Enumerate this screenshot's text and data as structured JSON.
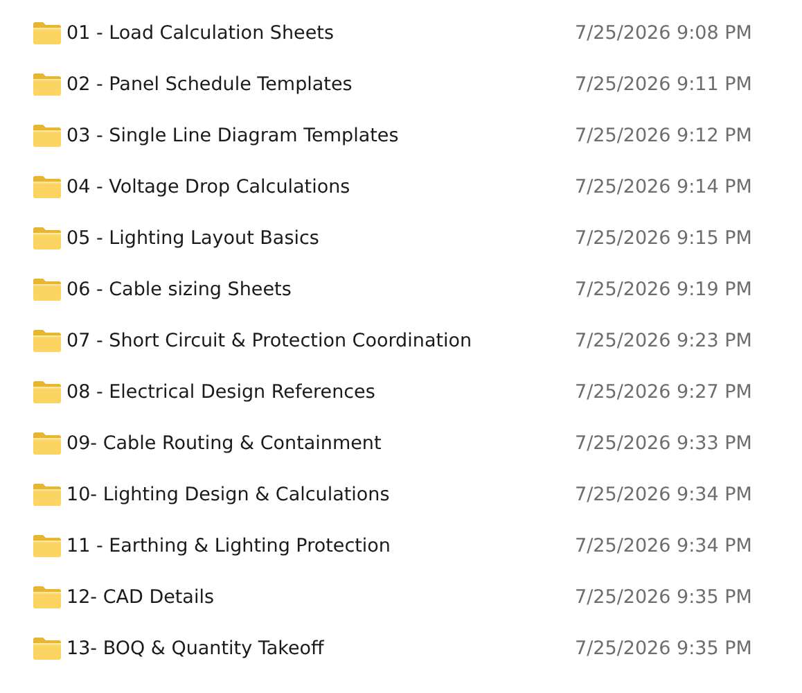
{
  "files": [
    {
      "name": "01 - Load Calculation Sheets",
      "modified": "7/25/2026 9:08 PM"
    },
    {
      "name": "02 - Panel Schedule Templates",
      "modified": "7/25/2026 9:11 PM"
    },
    {
      "name": "03 - Single Line Diagram Templates",
      "modified": "7/25/2026 9:12 PM"
    },
    {
      "name": "04 - Voltage Drop Calculations",
      "modified": "7/25/2026 9:14 PM"
    },
    {
      "name": "05 - Lighting Layout Basics",
      "modified": "7/25/2026 9:15 PM"
    },
    {
      "name": "06 - Cable sizing Sheets",
      "modified": "7/25/2026 9:19 PM"
    },
    {
      "name": "07 - Short Circuit & Protection Coordination",
      "modified": "7/25/2026 9:23 PM"
    },
    {
      "name": "08 - Electrical Design References",
      "modified": "7/25/2026 9:27 PM"
    },
    {
      "name": "09- Cable Routing & Containment",
      "modified": "7/25/2026 9:33 PM"
    },
    {
      "name": "10- Lighting Design & Calculations",
      "modified": "7/25/2026 9:34 PM"
    },
    {
      "name": "11 - Earthing & Lighting Protection",
      "modified": "7/25/2026 9:34 PM"
    },
    {
      "name": "12- CAD Details",
      "modified": "7/25/2026 9:35 PM"
    },
    {
      "name": "13- BOQ & Quantity Takeoff",
      "modified": "7/25/2026 9:35 PM"
    }
  ]
}
